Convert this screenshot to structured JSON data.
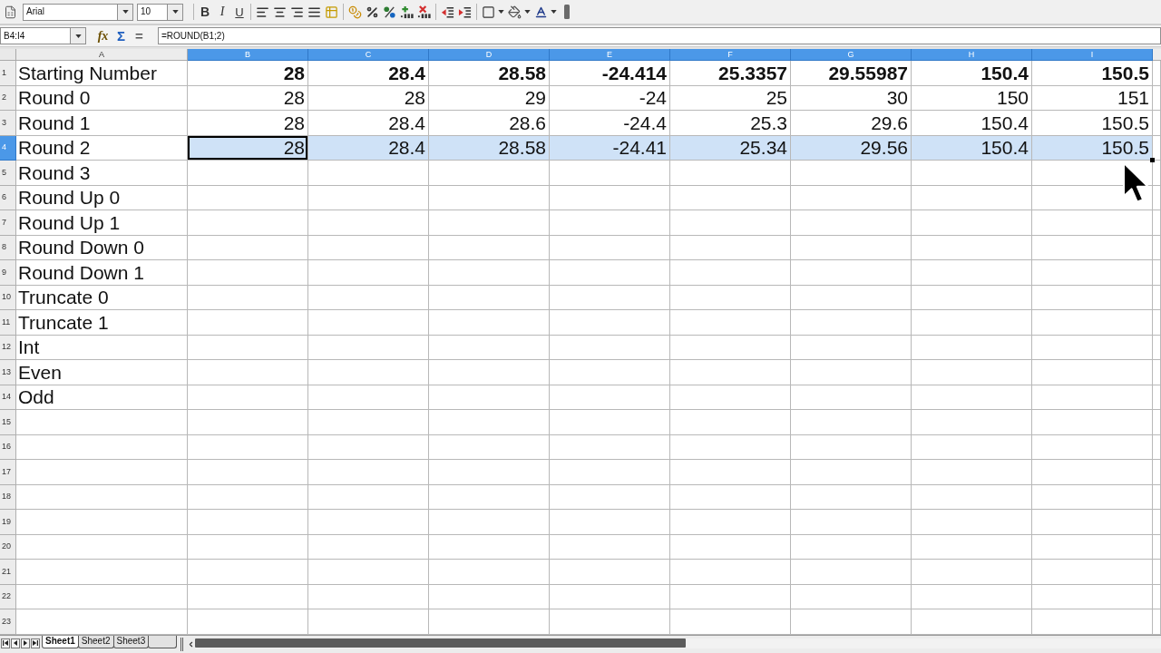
{
  "toolbar": {
    "font_name": "Arial",
    "font_size": "10",
    "style_buttons": [
      {
        "kind": "bold",
        "label": "B"
      },
      {
        "kind": "italic",
        "label": "I"
      },
      {
        "kind": "underline",
        "label": "U"
      }
    ]
  },
  "formula_bar": {
    "name_box": "B4:I4",
    "buttons": [
      {
        "kind": "wizard",
        "label": "fx"
      },
      {
        "kind": "sum",
        "label": "Σ"
      },
      {
        "kind": "equals",
        "label": "="
      }
    ],
    "formula": "=ROUND(B1;2)"
  },
  "columns": [
    {
      "label": "A",
      "selected": false
    },
    {
      "label": "B",
      "selected": true
    },
    {
      "label": "C",
      "selected": true
    },
    {
      "label": "D",
      "selected": true
    },
    {
      "label": "E",
      "selected": true
    },
    {
      "label": "F",
      "selected": true
    },
    {
      "label": "G",
      "selected": true
    },
    {
      "label": "H",
      "selected": true
    },
    {
      "label": "I",
      "selected": true
    }
  ],
  "rows": [
    {
      "number": "1",
      "selected": false,
      "bold": true,
      "label": "Starting Number",
      "values": [
        {
          "text": "28",
          "active": false
        },
        {
          "text": "28.4",
          "active": false
        },
        {
          "text": "28.58",
          "active": false
        },
        {
          "text": "-24.414",
          "active": false
        },
        {
          "text": "25.3357",
          "active": false
        },
        {
          "text": "29.55987",
          "active": false
        },
        {
          "text": "150.4",
          "active": false
        },
        {
          "text": "150.5",
          "active": false
        }
      ]
    },
    {
      "number": "2",
      "selected": false,
      "bold": false,
      "label": "Round 0",
      "values": [
        {
          "text": "28",
          "active": false
        },
        {
          "text": "28",
          "active": false
        },
        {
          "text": "29",
          "active": false
        },
        {
          "text": "-24",
          "active": false
        },
        {
          "text": "25",
          "active": false
        },
        {
          "text": "30",
          "active": false
        },
        {
          "text": "150",
          "active": false
        },
        {
          "text": "151",
          "active": false
        }
      ]
    },
    {
      "number": "3",
      "selected": false,
      "bold": false,
      "label": "Round 1",
      "values": [
        {
          "text": "28",
          "active": false
        },
        {
          "text": "28.4",
          "active": false
        },
        {
          "text": "28.6",
          "active": false
        },
        {
          "text": "-24.4",
          "active": false
        },
        {
          "text": "25.3",
          "active": false
        },
        {
          "text": "29.6",
          "active": false
        },
        {
          "text": "150.4",
          "active": false
        },
        {
          "text": "150.5",
          "active": false
        }
      ]
    },
    {
      "number": "4",
      "selected": true,
      "bold": false,
      "label": "Round 2",
      "values": [
        {
          "text": "28",
          "active": true
        },
        {
          "text": "28.4",
          "active": false
        },
        {
          "text": "28.58",
          "active": false
        },
        {
          "text": "-24.41",
          "active": false
        },
        {
          "text": "25.34",
          "active": false
        },
        {
          "text": "29.56",
          "active": false
        },
        {
          "text": "150.4",
          "active": false
        },
        {
          "text": "150.5",
          "active": false
        }
      ]
    },
    {
      "number": "5",
      "selected": false,
      "label": "Round 3"
    },
    {
      "number": "6",
      "selected": false,
      "label": "Round Up 0"
    },
    {
      "number": "7",
      "selected": false,
      "label": "Round Up 1"
    },
    {
      "number": "8",
      "selected": false,
      "label": "Round Down 0"
    },
    {
      "number": "9",
      "selected": false,
      "label": "Round Down 1"
    },
    {
      "number": "10",
      "selected": false,
      "label": "Truncate 0"
    },
    {
      "number": "11",
      "selected": false,
      "label": "Truncate 1"
    },
    {
      "number": "12",
      "selected": false,
      "label": "Int"
    },
    {
      "number": "13",
      "selected": false,
      "label": "Even"
    },
    {
      "number": "14",
      "selected": false,
      "label": "Odd"
    },
    {
      "number": "15",
      "selected": false
    },
    {
      "number": "16",
      "selected": false
    },
    {
      "number": "17",
      "selected": false
    },
    {
      "number": "18",
      "selected": false
    },
    {
      "number": "19",
      "selected": false
    },
    {
      "number": "20",
      "selected": false
    },
    {
      "number": "21",
      "selected": false
    },
    {
      "number": "22",
      "selected": false
    },
    {
      "number": "23",
      "selected": false
    }
  ],
  "sheet_tabs": [
    {
      "label": "Sheet1",
      "selected": true
    },
    {
      "label": "Sheet2",
      "selected": false
    },
    {
      "label": "Sheet3",
      "selected": false
    }
  ]
}
